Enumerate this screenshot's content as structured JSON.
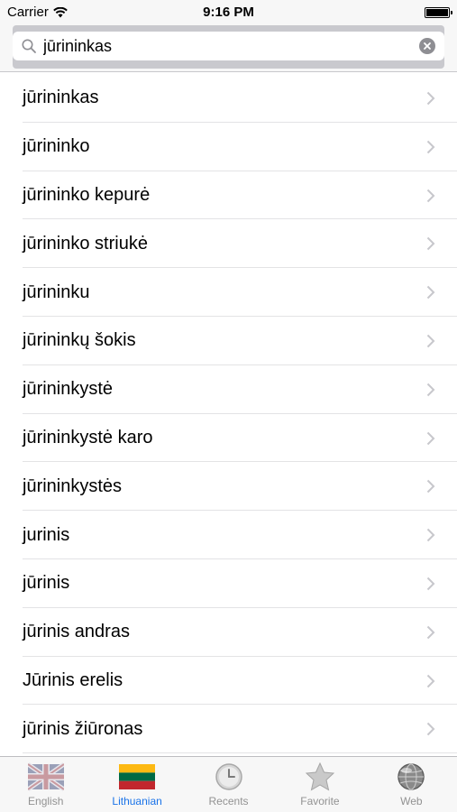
{
  "status_bar": {
    "carrier": "Carrier",
    "time": "9:16 PM"
  },
  "search": {
    "value": "jūrininkas",
    "placeholder": ""
  },
  "results": [
    "jūrininkas",
    "jūrininko",
    "jūrininko kepurė",
    "jūrininko striukė",
    "jūrininku",
    "jūrininkų šokis",
    "jūrininkystė",
    "jūrininkystė karo",
    "jūrininkystės",
    "jurinis",
    "jūrinis",
    "jūrinis andras",
    "Jūrinis erelis",
    "jūrinis žiūronas"
  ],
  "tabs": [
    {
      "label": "English",
      "icon": "uk-flag-icon"
    },
    {
      "label": "Lithuanian",
      "icon": "lithuania-flag-icon",
      "active": true
    },
    {
      "label": "Recents",
      "icon": "clock-icon"
    },
    {
      "label": "Favorite",
      "icon": "star-icon"
    },
    {
      "label": "Web",
      "icon": "globe-icon"
    }
  ],
  "colors": {
    "active_tab": "#1a73e8",
    "inactive_tab": "#929292"
  }
}
